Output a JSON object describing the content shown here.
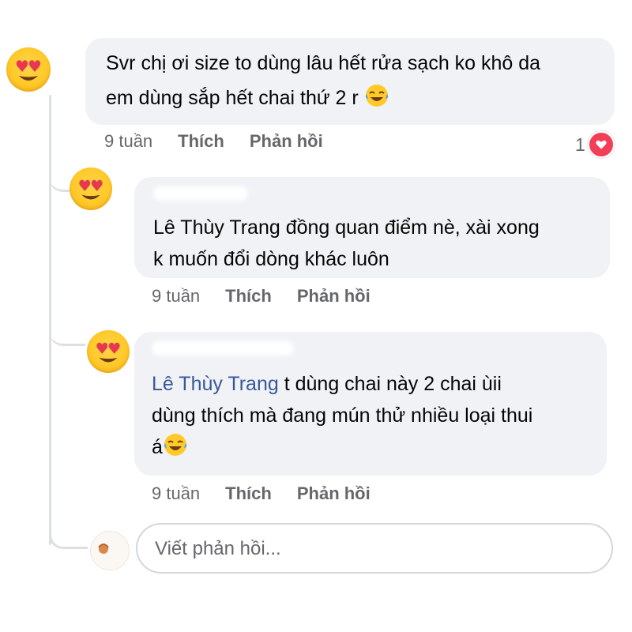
{
  "comments": [
    {
      "text_lines": [
        "Svr chị ơi size to dùng lâu hết rửa sạch ko khô da",
        "em dùng sắp hết chai thứ 2 r"
      ],
      "time": "9 tuần",
      "like_label": "Thích",
      "reply_label": "Phản hồi",
      "reaction_count": "1",
      "avatar_icon": "heart-eyes-emoji-icon",
      "trailing_icon": "tears-of-joy-emoji-icon"
    },
    {
      "text_lines": [
        "Lê Thùy Trang đồng quan điểm nè, xài xong",
        "k muốn đổi dòng khác luôn"
      ],
      "time": "9 tuần",
      "like_label": "Thích",
      "reply_label": "Phản hồi",
      "avatar_icon": "heart-eyes-emoji-icon"
    },
    {
      "mention": "Lê Thùy Trang",
      "line1_rest": " t dùng chai này 2 chai ùii",
      "line2": "dùng thích mà đang mún thử nhiều loại thui",
      "line3": "á",
      "time": "9 tuần",
      "like_label": "Thích",
      "reply_label": "Phản hồi",
      "avatar_icon": "heart-eyes-emoji-icon",
      "trailing_icon": "tears-of-joy-emoji-icon"
    }
  ],
  "reply_box": {
    "placeholder": "Viết phản hồi..."
  },
  "colors": {
    "bubble": "#f0f2f5",
    "meta_text": "#65676b",
    "mention": "#385898",
    "heart": "#f33e58",
    "thread_line": "#dcdfe4"
  }
}
